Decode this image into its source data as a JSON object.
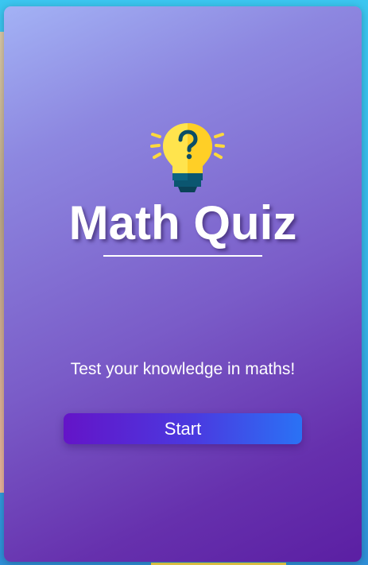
{
  "quiz": {
    "icon": "lightbulb-question-icon",
    "title": "Math Quiz",
    "tagline": "Test your knowledge in maths!",
    "start_label": "Start"
  },
  "colors": {
    "card_gradient_start": "#a3b2f5",
    "card_gradient_end": "#5b1fa3",
    "button_gradient_start": "#6414c8",
    "button_gradient_end": "#2a72f5",
    "bulb_yellow": "#ffd93b",
    "bulb_base": "#0b4d66"
  }
}
